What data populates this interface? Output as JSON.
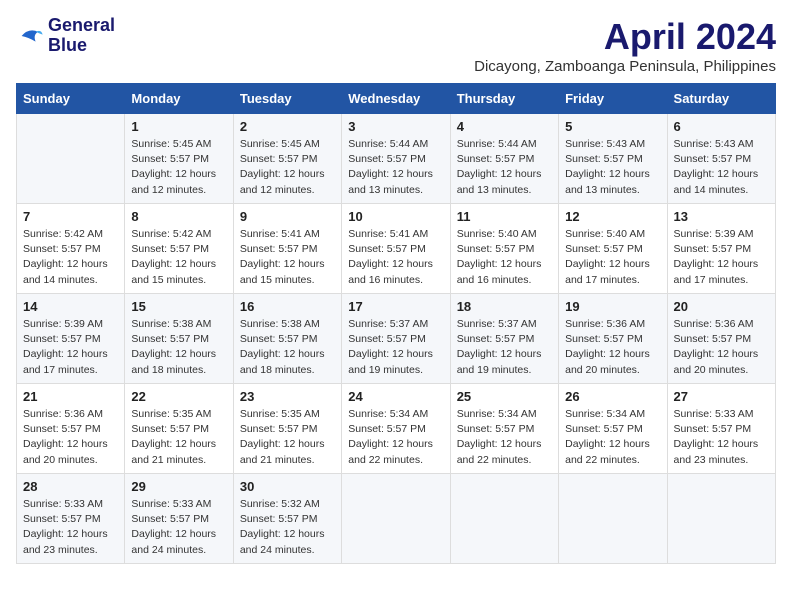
{
  "header": {
    "logo_line1": "General",
    "logo_line2": "Blue",
    "month": "April 2024",
    "location": "Dicayong, Zamboanga Peninsula, Philippines"
  },
  "weekdays": [
    "Sunday",
    "Monday",
    "Tuesday",
    "Wednesday",
    "Thursday",
    "Friday",
    "Saturday"
  ],
  "weeks": [
    [
      {
        "day": "",
        "info": ""
      },
      {
        "day": "1",
        "info": "Sunrise: 5:45 AM\nSunset: 5:57 PM\nDaylight: 12 hours\nand 12 minutes."
      },
      {
        "day": "2",
        "info": "Sunrise: 5:45 AM\nSunset: 5:57 PM\nDaylight: 12 hours\nand 12 minutes."
      },
      {
        "day": "3",
        "info": "Sunrise: 5:44 AM\nSunset: 5:57 PM\nDaylight: 12 hours\nand 13 minutes."
      },
      {
        "day": "4",
        "info": "Sunrise: 5:44 AM\nSunset: 5:57 PM\nDaylight: 12 hours\nand 13 minutes."
      },
      {
        "day": "5",
        "info": "Sunrise: 5:43 AM\nSunset: 5:57 PM\nDaylight: 12 hours\nand 13 minutes."
      },
      {
        "day": "6",
        "info": "Sunrise: 5:43 AM\nSunset: 5:57 PM\nDaylight: 12 hours\nand 14 minutes."
      }
    ],
    [
      {
        "day": "7",
        "info": "Sunrise: 5:42 AM\nSunset: 5:57 PM\nDaylight: 12 hours\nand 14 minutes."
      },
      {
        "day": "8",
        "info": "Sunrise: 5:42 AM\nSunset: 5:57 PM\nDaylight: 12 hours\nand 15 minutes."
      },
      {
        "day": "9",
        "info": "Sunrise: 5:41 AM\nSunset: 5:57 PM\nDaylight: 12 hours\nand 15 minutes."
      },
      {
        "day": "10",
        "info": "Sunrise: 5:41 AM\nSunset: 5:57 PM\nDaylight: 12 hours\nand 16 minutes."
      },
      {
        "day": "11",
        "info": "Sunrise: 5:40 AM\nSunset: 5:57 PM\nDaylight: 12 hours\nand 16 minutes."
      },
      {
        "day": "12",
        "info": "Sunrise: 5:40 AM\nSunset: 5:57 PM\nDaylight: 12 hours\nand 17 minutes."
      },
      {
        "day": "13",
        "info": "Sunrise: 5:39 AM\nSunset: 5:57 PM\nDaylight: 12 hours\nand 17 minutes."
      }
    ],
    [
      {
        "day": "14",
        "info": "Sunrise: 5:39 AM\nSunset: 5:57 PM\nDaylight: 12 hours\nand 17 minutes."
      },
      {
        "day": "15",
        "info": "Sunrise: 5:38 AM\nSunset: 5:57 PM\nDaylight: 12 hours\nand 18 minutes."
      },
      {
        "day": "16",
        "info": "Sunrise: 5:38 AM\nSunset: 5:57 PM\nDaylight: 12 hours\nand 18 minutes."
      },
      {
        "day": "17",
        "info": "Sunrise: 5:37 AM\nSunset: 5:57 PM\nDaylight: 12 hours\nand 19 minutes."
      },
      {
        "day": "18",
        "info": "Sunrise: 5:37 AM\nSunset: 5:57 PM\nDaylight: 12 hours\nand 19 minutes."
      },
      {
        "day": "19",
        "info": "Sunrise: 5:36 AM\nSunset: 5:57 PM\nDaylight: 12 hours\nand 20 minutes."
      },
      {
        "day": "20",
        "info": "Sunrise: 5:36 AM\nSunset: 5:57 PM\nDaylight: 12 hours\nand 20 minutes."
      }
    ],
    [
      {
        "day": "21",
        "info": "Sunrise: 5:36 AM\nSunset: 5:57 PM\nDaylight: 12 hours\nand 20 minutes."
      },
      {
        "day": "22",
        "info": "Sunrise: 5:35 AM\nSunset: 5:57 PM\nDaylight: 12 hours\nand 21 minutes."
      },
      {
        "day": "23",
        "info": "Sunrise: 5:35 AM\nSunset: 5:57 PM\nDaylight: 12 hours\nand 21 minutes."
      },
      {
        "day": "24",
        "info": "Sunrise: 5:34 AM\nSunset: 5:57 PM\nDaylight: 12 hours\nand 22 minutes."
      },
      {
        "day": "25",
        "info": "Sunrise: 5:34 AM\nSunset: 5:57 PM\nDaylight: 12 hours\nand 22 minutes."
      },
      {
        "day": "26",
        "info": "Sunrise: 5:34 AM\nSunset: 5:57 PM\nDaylight: 12 hours\nand 22 minutes."
      },
      {
        "day": "27",
        "info": "Sunrise: 5:33 AM\nSunset: 5:57 PM\nDaylight: 12 hours\nand 23 minutes."
      }
    ],
    [
      {
        "day": "28",
        "info": "Sunrise: 5:33 AM\nSunset: 5:57 PM\nDaylight: 12 hours\nand 23 minutes."
      },
      {
        "day": "29",
        "info": "Sunrise: 5:33 AM\nSunset: 5:57 PM\nDaylight: 12 hours\nand 24 minutes."
      },
      {
        "day": "30",
        "info": "Sunrise: 5:32 AM\nSunset: 5:57 PM\nDaylight: 12 hours\nand 24 minutes."
      },
      {
        "day": "",
        "info": ""
      },
      {
        "day": "",
        "info": ""
      },
      {
        "day": "",
        "info": ""
      },
      {
        "day": "",
        "info": ""
      }
    ]
  ]
}
